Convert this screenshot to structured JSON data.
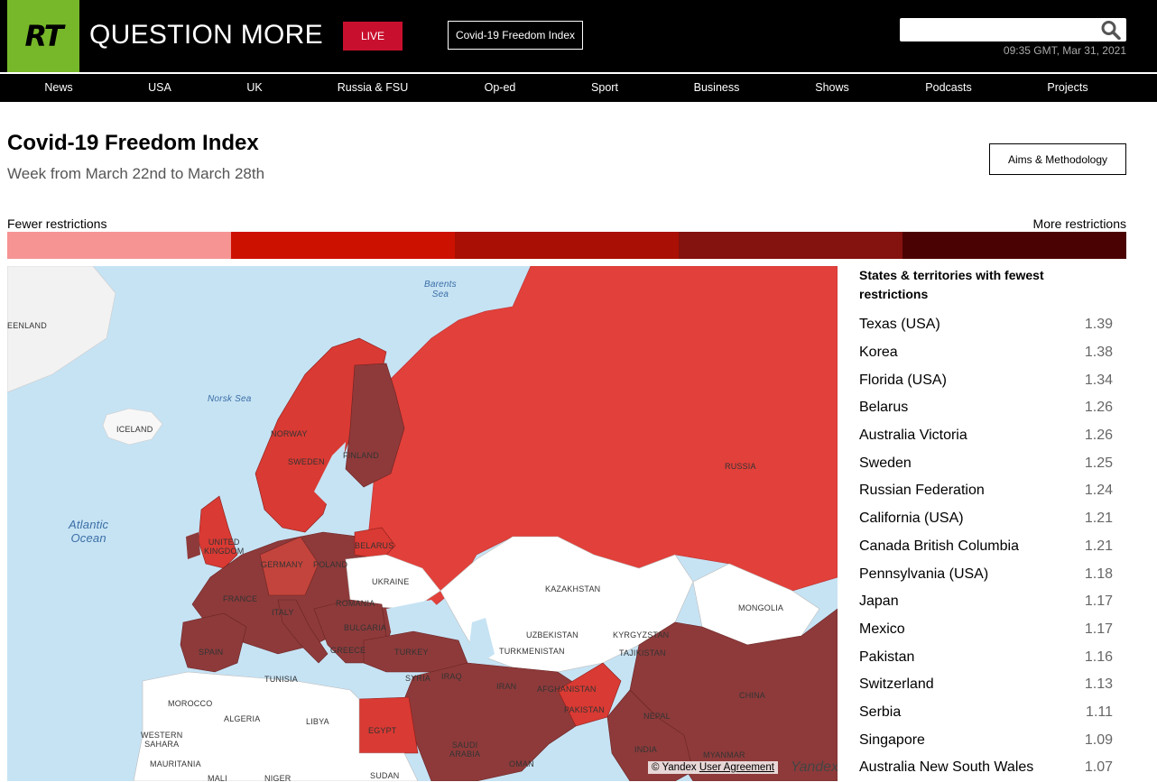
{
  "header": {
    "logo_text": "RT",
    "slogan": "QUESTION MORE",
    "live_label": "LIVE",
    "freedom_index_label": "Covid-19 Freedom Index",
    "search_placeholder": "",
    "timestamp": "09:35 GMT, Mar 31, 2021",
    "logo_color": "#77b82a",
    "live_color": "#c8102e"
  },
  "nav": {
    "items": [
      "News",
      "USA",
      "UK",
      "Russia & FSU",
      "Op-ed",
      "Sport",
      "Business",
      "Shows",
      "Podcasts",
      "Projects"
    ]
  },
  "page": {
    "title": "Covid-19 Freedom Index",
    "subtitle": "Week from March 22nd to March 28th",
    "aims_label": "Aims & Methodology"
  },
  "legend": {
    "fewer_label": "Fewer restrictions",
    "more_label": "More restrictions",
    "colors": [
      "#f69494",
      "#cd1100",
      "#a90f04",
      "#84120f",
      "#4b0202"
    ]
  },
  "map": {
    "labels": {
      "greenland": "EENLAND",
      "barents": "Barents\nSea",
      "norsk": "Norsk Sea",
      "iceland": "ICELAND",
      "atlantic": "Atlantic\nOcean",
      "norway": "NORWAY",
      "sweden": "SWEDEN",
      "finland": "FINLAND",
      "russia": "RUSSIA",
      "uk": "UNITED\nKINGDOM",
      "belarus": "BELARUS",
      "germany": "GERMANY",
      "poland": "POLAND",
      "ukraine": "UKRAINE",
      "kazakhstan": "KAZAKHSTAN",
      "france": "FRANCE",
      "romania": "ROMANIA",
      "mongolia": "MONGOLIA",
      "italy": "ITALY",
      "bulgaria": "BULGARIA",
      "uzbekistan": "UZBEKISTAN",
      "kyrgyzstan": "KYRGYZSTAN",
      "spain": "SPAIN",
      "greece": "GREECE",
      "turkey": "TURKEY",
      "turkmenistan": "TURKMENISTAN",
      "tajikistan": "TAJIKISTAN",
      "tunisia": "TUNISIA",
      "syria": "SYRIA",
      "iraq": "IRAQ",
      "iran": "IRAN",
      "afghanistan": "AFGHANISTAN",
      "china": "CHINA",
      "morocco": "MOROCCO",
      "pakistan": "PAKISTAN",
      "algeria": "ALGERIA",
      "libya": "LIBYA",
      "egypt": "EGYPT",
      "nepal": "NEPAL",
      "western_sahara": "WESTERN\nSAHARA",
      "saudi": "SAUDI\nARABIA",
      "india": "INDIA",
      "oman": "OMAN",
      "myanmar": "MYANMAR",
      "mauritania": "MAURITANIA",
      "mali": "MALI",
      "niger": "NIGER",
      "sudan": "SUDAN"
    },
    "copyright": "© Yandex",
    "agreement": "User Agreement",
    "yandex_logo": "Yandex"
  },
  "panel": {
    "heading": "States & territories with fewest restrictions",
    "rows": [
      {
        "name": "Texas (USA)",
        "value": "1.39"
      },
      {
        "name": "Korea",
        "value": "1.38"
      },
      {
        "name": "Florida (USA)",
        "value": "1.34"
      },
      {
        "name": "Belarus",
        "value": "1.26"
      },
      {
        "name": "Australia Victoria",
        "value": "1.26"
      },
      {
        "name": "Sweden",
        "value": "1.25"
      },
      {
        "name": "Russian Federation",
        "value": "1.24"
      },
      {
        "name": "California (USA)",
        "value": "1.21"
      },
      {
        "name": "Canada British Columbia",
        "value": "1.21"
      },
      {
        "name": "Pennsylvania (USA)",
        "value": "1.18"
      },
      {
        "name": "Japan",
        "value": "1.17"
      },
      {
        "name": "Mexico",
        "value": "1.17"
      },
      {
        "name": "Pakistan",
        "value": "1.16"
      },
      {
        "name": "Switzerland",
        "value": "1.13"
      },
      {
        "name": "Serbia",
        "value": "1.11"
      },
      {
        "name": "Singapore",
        "value": "1.09"
      },
      {
        "name": "Australia New South Wales",
        "value": "1.07"
      }
    ]
  }
}
